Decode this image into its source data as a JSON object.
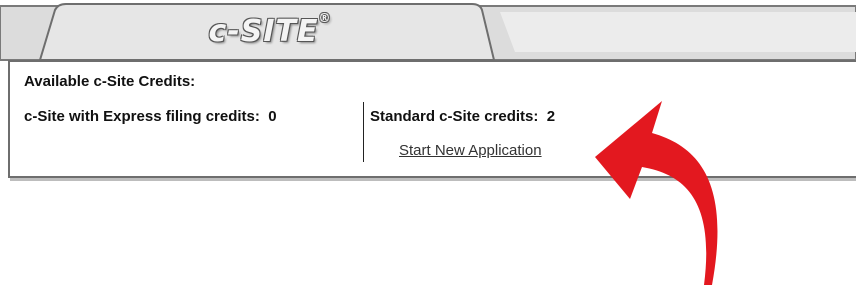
{
  "tab": {
    "title": "c-SITE",
    "mark": "®"
  },
  "panel": {
    "heading": "Available c-Site Credits:",
    "express_label": "c-Site with Express filing credits:",
    "express_value": "0",
    "standard_label": "Standard c-Site credits:",
    "standard_value": "2",
    "start_link": "Start New Application"
  },
  "colors": {
    "arrow": "#e3181f",
    "tab_fill": "#e6e6e6",
    "panel_border": "#6e6e6e"
  },
  "icons": {
    "arrow": "curved-arrow-icon"
  }
}
